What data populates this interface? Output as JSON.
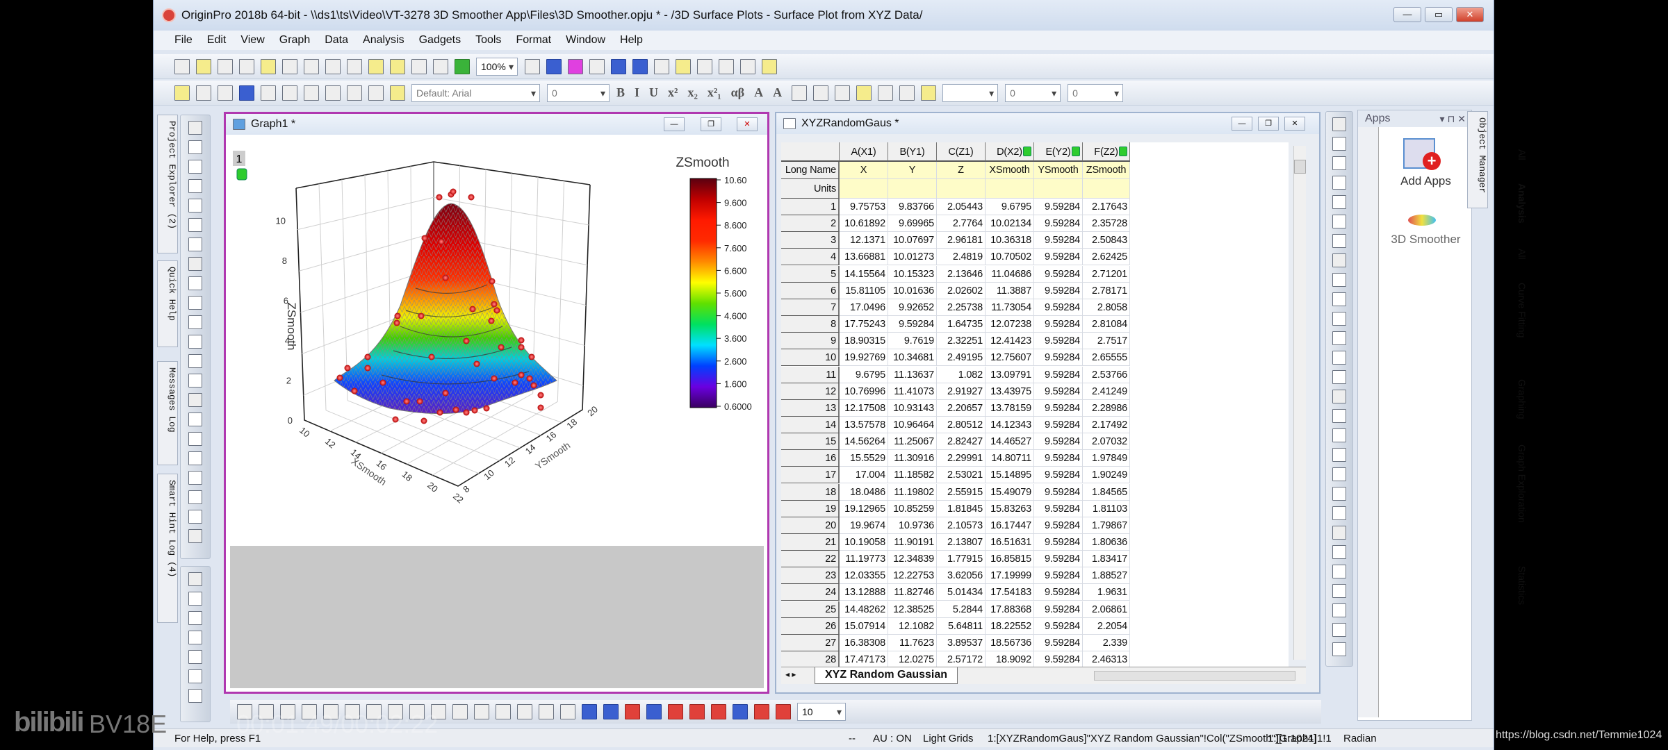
{
  "app": {
    "title": "OriginPro 2018b 64-bit - \\\\ds1\\ts\\Video\\VT-3278 3D Smoother App\\Files\\3D Smoother.opju * - /3D Surface Plots - Surface Plot from XYZ Data/",
    "controls": {
      "minimize": "—",
      "maximize": "▭",
      "close": "✕"
    }
  },
  "menu": [
    "File",
    "Edit",
    "View",
    "Graph",
    "Data",
    "Analysis",
    "Gadgets",
    "Tools",
    "Format",
    "Window",
    "Help"
  ],
  "toolbar": {
    "zoom": "100%",
    "font": "Default: Arial",
    "font_size": "0",
    "format_buttons": [
      "B",
      "I",
      "U",
      "x²",
      "x₂",
      "x²₁",
      "αβ",
      "A",
      "A"
    ],
    "line_width": "0",
    "line_width2": "0"
  },
  "left_panel_tabs": [
    "Project Explorer (2)",
    "Quick Help",
    "Messages Log",
    "Smart Hint Log (4)"
  ],
  "graph_window": {
    "title": "Graph1 *",
    "layer": "1",
    "zlabel": "ZSmooth",
    "xlabel": "XSmooth",
    "ylabel": "YSmooth",
    "z_ticks": [
      "0",
      "2",
      "4",
      "6",
      "8",
      "10"
    ],
    "x_ticks": [
      "10",
      "12",
      "14",
      "16",
      "18",
      "20",
      "22"
    ],
    "y_ticks": [
      "8",
      "10",
      "12",
      "14",
      "16",
      "18",
      "20"
    ],
    "colorbar": {
      "title": "ZSmooth",
      "ticks": [
        "10.60",
        "9.600",
        "8.600",
        "7.600",
        "6.600",
        "5.600",
        "4.600",
        "3.600",
        "2.600",
        "1.600",
        "0.6000"
      ],
      "colormap": [
        "#5a0010",
        "#c00000",
        "#ff1a00",
        "#ff2a00",
        "#ff8a00",
        "#ffff00",
        "#60e000",
        "#00e060",
        "#00e0ff",
        "#0040ff",
        "#6a00e0",
        "#3a0060"
      ]
    },
    "scatter_color": "#d00000"
  },
  "worksheet": {
    "title": "XYZRandomGaus *",
    "row_labels": {
      "long_name": "Long Name",
      "units": "Units"
    },
    "columns": [
      {
        "name": "A(X1)",
        "long_name": "X"
      },
      {
        "name": "B(Y1)",
        "long_name": "Y"
      },
      {
        "name": "C(Z1)",
        "long_name": "Z"
      },
      {
        "name": "D(X2)",
        "long_name": "XSmooth",
        "locked": true
      },
      {
        "name": "E(Y2)",
        "long_name": "YSmooth",
        "locked": true
      },
      {
        "name": "F(Z2)",
        "long_name": "ZSmooth",
        "locked": true
      }
    ],
    "rows": [
      [
        "1",
        "9.75753",
        "9.83766",
        "2.05443",
        "9.6795",
        "9.59284",
        "2.17643"
      ],
      [
        "2",
        "10.61892",
        "9.69965",
        "2.7764",
        "10.02134",
        "9.59284",
        "2.35728"
      ],
      [
        "3",
        "12.1371",
        "10.07697",
        "2.96181",
        "10.36318",
        "9.59284",
        "2.50843"
      ],
      [
        "4",
        "13.66881",
        "10.01273",
        "2.4819",
        "10.70502",
        "9.59284",
        "2.62425"
      ],
      [
        "5",
        "14.15564",
        "10.15323",
        "2.13646",
        "11.04686",
        "9.59284",
        "2.71201"
      ],
      [
        "6",
        "15.81105",
        "10.01636",
        "2.02602",
        "11.3887",
        "9.59284",
        "2.78171"
      ],
      [
        "7",
        "17.0496",
        "9.92652",
        "2.25738",
        "11.73054",
        "9.59284",
        "2.8058"
      ],
      [
        "8",
        "17.75243",
        "9.59284",
        "1.64735",
        "12.07238",
        "9.59284",
        "2.81084"
      ],
      [
        "9",
        "18.90315",
        "9.7619",
        "2.32251",
        "12.41423",
        "9.59284",
        "2.7517"
      ],
      [
        "10",
        "19.92769",
        "10.34681",
        "2.49195",
        "12.75607",
        "9.59284",
        "2.65555"
      ],
      [
        "11",
        "9.6795",
        "11.13637",
        "1.082",
        "13.09791",
        "9.59284",
        "2.53766"
      ],
      [
        "12",
        "10.76996",
        "11.41073",
        "2.91927",
        "13.43975",
        "9.59284",
        "2.41249"
      ],
      [
        "13",
        "12.17508",
        "10.93143",
        "2.20657",
        "13.78159",
        "9.59284",
        "2.28986"
      ],
      [
        "14",
        "13.57578",
        "10.96464",
        "2.80512",
        "14.12343",
        "9.59284",
        "2.17492"
      ],
      [
        "15",
        "14.56264",
        "11.25067",
        "2.82427",
        "14.46527",
        "9.59284",
        "2.07032"
      ],
      [
        "16",
        "15.5529",
        "11.30916",
        "2.29991",
        "14.80711",
        "9.59284",
        "1.97849"
      ],
      [
        "17",
        "17.004",
        "11.18582",
        "2.53021",
        "15.14895",
        "9.59284",
        "1.90249"
      ],
      [
        "18",
        "18.0486",
        "11.19802",
        "2.55915",
        "15.49079",
        "9.59284",
        "1.84565"
      ],
      [
        "19",
        "19.12965",
        "10.85259",
        "1.81845",
        "15.83263",
        "9.59284",
        "1.81103"
      ],
      [
        "20",
        "19.9674",
        "10.9736",
        "2.10573",
        "16.17447",
        "9.59284",
        "1.79867"
      ],
      [
        "21",
        "10.19058",
        "11.90191",
        "2.13807",
        "16.51631",
        "9.59284",
        "1.80636"
      ],
      [
        "22",
        "11.19773",
        "12.34839",
        "1.77915",
        "16.85815",
        "9.59284",
        "1.83417"
      ],
      [
        "23",
        "12.03355",
        "12.22753",
        "3.62056",
        "17.19999",
        "9.59284",
        "1.88527"
      ],
      [
        "24",
        "13.12888",
        "11.82746",
        "5.01434",
        "17.54183",
        "9.59284",
        "1.9631"
      ],
      [
        "25",
        "14.48262",
        "12.38525",
        "5.2844",
        "17.88368",
        "9.59284",
        "2.06861"
      ],
      [
        "26",
        "15.07914",
        "12.1082",
        "5.64811",
        "18.22552",
        "9.59284",
        "2.2054"
      ],
      [
        "27",
        "16.38308",
        "11.7623",
        "3.89537",
        "18.56736",
        "9.59284",
        "2.339"
      ],
      [
        "28",
        "17.47173",
        "12.0275",
        "2.57172",
        "18.9092",
        "9.59284",
        "2.46313"
      ]
    ],
    "sheet_tab": "XYZ Random Gaussian"
  },
  "apps_panel": {
    "title": "Apps",
    "tabs": [
      "All",
      "Analysis",
      "All",
      "Curve Fitting",
      "Graphing",
      "Graph Exploration",
      "Statistics"
    ],
    "items": [
      {
        "label": "Add Apps"
      },
      {
        "label": "3D Smoother"
      }
    ]
  },
  "object_manager": "Object Manager",
  "bottom_toolbar": {
    "value": "10"
  },
  "status": {
    "help": "For Help, press F1",
    "separator": "--",
    "au": "AU : ON",
    "grids": "Light Grids",
    "dataset": "1:[XYZRandomGaus]\"XYZ Random Gaussian\"!Col(\"ZSmooth\")[1:1024]",
    "layer": "1:[Graph1]1!1",
    "angle": "Radian"
  },
  "overlay": {
    "watermark": "BV18E",
    "timestamp": "00:01:49/00:02:22",
    "url": "https://blog.csdn.net/Temmie1024"
  }
}
